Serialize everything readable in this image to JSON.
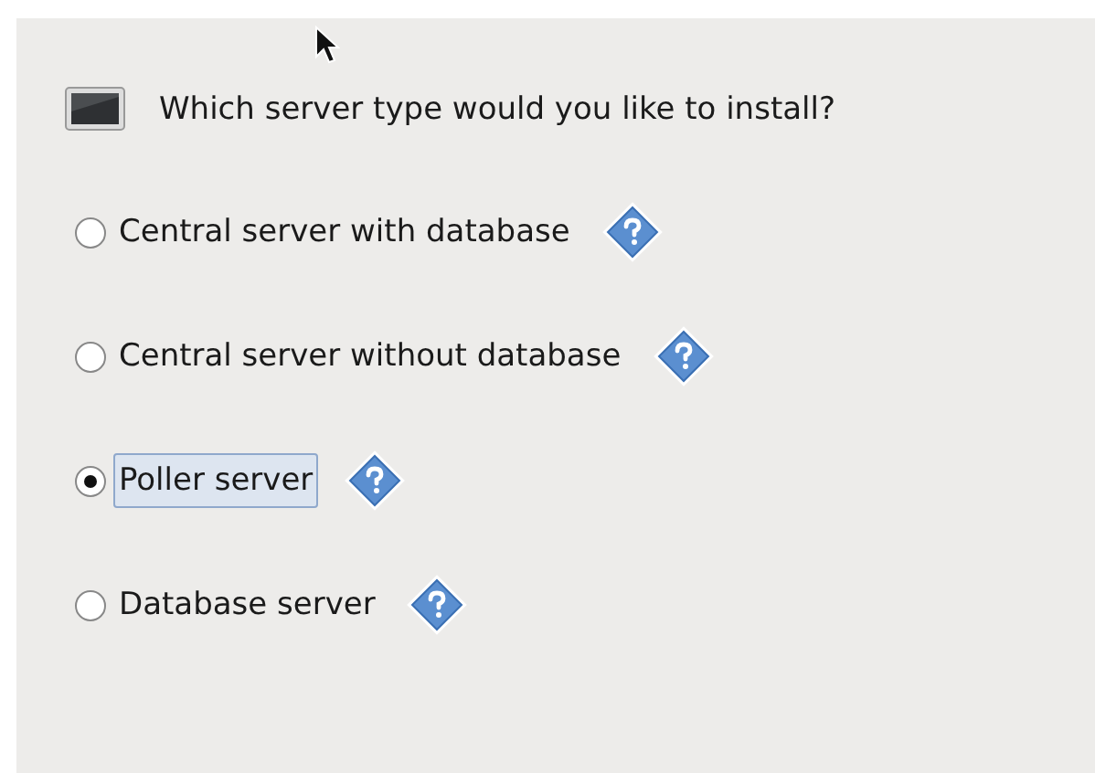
{
  "question": "Which server type would you like to install?",
  "options": [
    {
      "label": "Central server with database",
      "selected": false
    },
    {
      "label": "Central server without database",
      "selected": false
    },
    {
      "label": "Poller server",
      "selected": true
    },
    {
      "label": "Database server",
      "selected": false
    }
  ]
}
